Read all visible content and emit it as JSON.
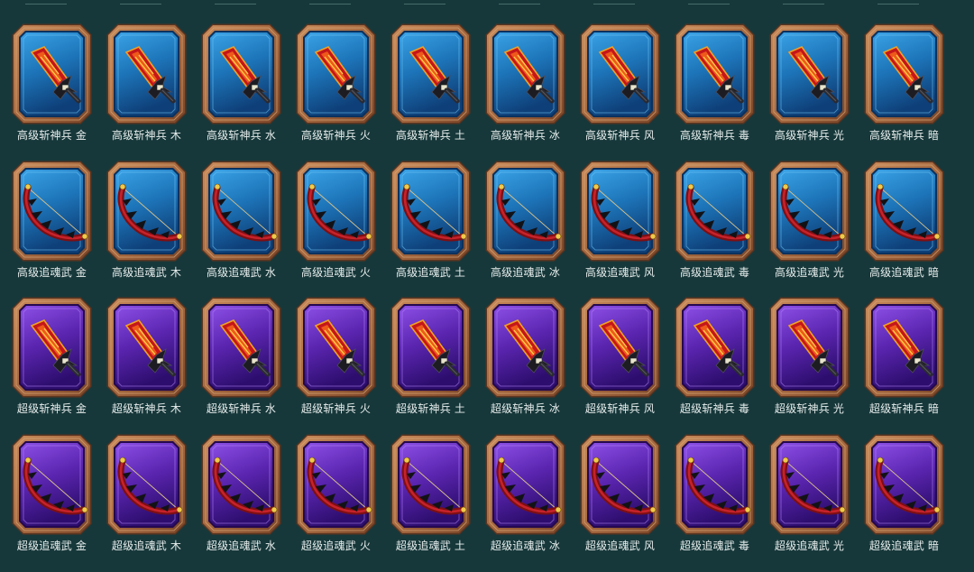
{
  "colors": {
    "background": "#17383a",
    "frame_bronze": "#a5683f",
    "frame_shadow": "#5c3520",
    "card_blue": "#1d74b8",
    "card_purple": "#5b25b0",
    "label": "#e6ecec"
  },
  "rows": [
    {
      "tier": "blue",
      "icon": "sword-icon",
      "items": [
        "高级斩神兵 金",
        "高级斩神兵 木",
        "高级斩神兵 水",
        "高级斩神兵 火",
        "高级斩神兵 土",
        "高级斩神兵 冰",
        "高级斩神兵 风",
        "高级斩神兵 毒",
        "高级斩神兵 光",
        "高级斩神兵 暗"
      ]
    },
    {
      "tier": "blue",
      "icon": "bow-icon",
      "items": [
        "高级追魂武 金",
        "高级追魂武 木",
        "高级追魂武 水",
        "高级追魂武 火",
        "高级追魂武 土",
        "高级追魂武 冰",
        "高级追魂武 风",
        "高级追魂武 毒",
        "高级追魂武 光",
        "高级追魂武 暗"
      ]
    },
    {
      "tier": "purple",
      "icon": "sword-icon",
      "items": [
        "超级斩神兵 金",
        "超级斩神兵 木",
        "超级斩神兵 水",
        "超级斩神兵 火",
        "超级斩神兵 土",
        "超级斩神兵 冰",
        "超级斩神兵 风",
        "超级斩神兵 毒",
        "超级斩神兵 光",
        "超级斩神兵 暗"
      ]
    },
    {
      "tier": "purple",
      "icon": "bow-icon",
      "items": [
        "超级追魂武 金",
        "超级追魂武 木",
        "超级追魂武 水",
        "超级追魂武 火",
        "超级追魂武 土",
        "超级追魂武 冰",
        "超级追魂武 风",
        "超级追魂武 毒",
        "超级追魂武 光",
        "超级追魂武 暗"
      ]
    }
  ]
}
